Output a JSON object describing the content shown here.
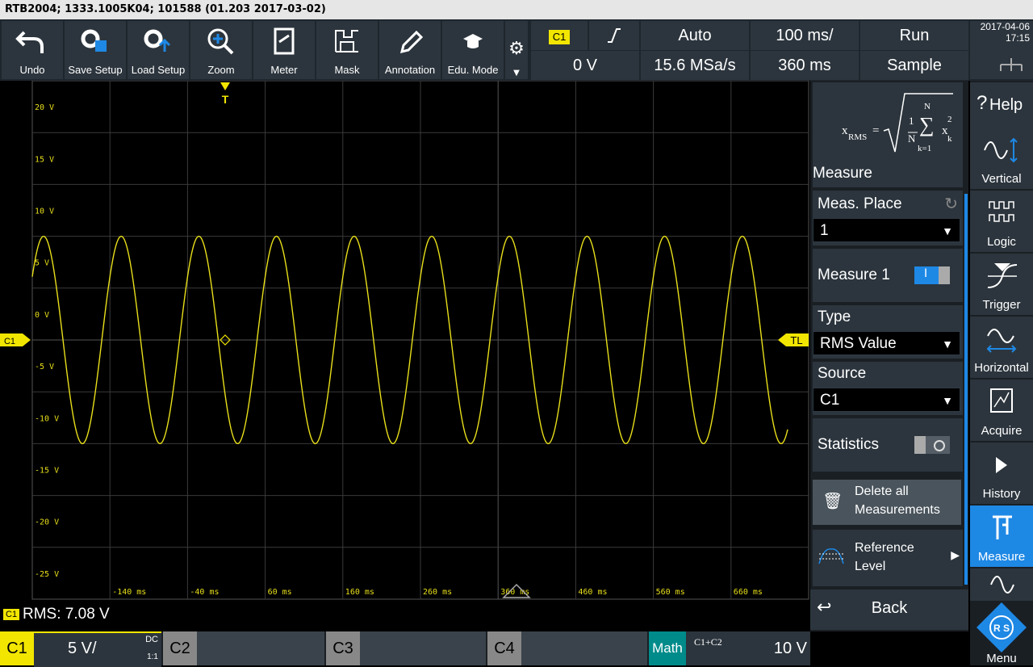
{
  "titlebar": {
    "text": "RTB2004; 1333.1005K04; 101588 (01.203 2017-03-02)"
  },
  "toolbar": {
    "undo": "Undo",
    "save_setup": "Save Setup",
    "load_setup": "Load Setup",
    "zoom": "Zoom",
    "meter": "Meter",
    "mask": "Mask",
    "annotation": "Annotation",
    "edu_mode": "Edu. Mode"
  },
  "header": {
    "trig_channel": "C1",
    "trig_level": "0 V",
    "trig_mode": "Auto",
    "sample_rate": "15.6 MSa/s",
    "time_scale": "100 ms/",
    "time_pos": "360 ms",
    "run_state": "Run",
    "acq_mode": "Sample",
    "date": "2017-04-06",
    "time": "17:15"
  },
  "grid": {
    "y_labels": [
      "20 V",
      "15 V",
      "10 V",
      "5 V",
      "0 V",
      "-5 V",
      "-10 V",
      "-15 V",
      "-20 V",
      "-25 V"
    ],
    "x_labels": [
      "-140 ms",
      "-40 ms",
      "60 ms",
      "160 ms",
      "260 ms",
      "360 ms",
      "460 ms",
      "560 ms",
      "660 ms"
    ],
    "trigger_marker": "T",
    "channel_marker": "C1",
    "trigger_level_marker": "TL"
  },
  "waveform": {
    "color": "#e8df1a",
    "amplitude_v": 10,
    "period_ms": 100
  },
  "measure_panel": {
    "formula_lhs": "x",
    "formula_sub": "RMS",
    "formula_frac_num": "1",
    "formula_frac_den": "N",
    "formula_sum_top": "N",
    "formula_sum_bottom": "k=1",
    "formula_var": "x",
    "formula_var_sup": "2",
    "formula_var_sub": "k",
    "title": "Measure",
    "meas_place_label": "Meas. Place",
    "meas_place_value": "1",
    "measure1_label": "Measure 1",
    "measure1_toggle_text": "I",
    "type_label": "Type",
    "type_value": "RMS Value",
    "source_label": "Source",
    "source_value": "C1",
    "statistics_label": "Statistics",
    "delete_all_line1": "Delete all",
    "delete_all_line2": "Measurements",
    "reference_line1": "Reference",
    "reference_line2": "Level",
    "back_label": "Back"
  },
  "rightbar": {
    "help": "Help",
    "vertical": "Vertical",
    "logic": "Logic",
    "trigger": "Trigger",
    "horizontal": "Horizontal",
    "acquire": "Acquire",
    "history": "History",
    "measure": "Measure",
    "menu": "Menu"
  },
  "status": {
    "channel": "C1",
    "rms_text": "RMS: 7.08 V"
  },
  "channels": {
    "c1_label": "C1",
    "c1_scale": "5 V/",
    "c1_coupling": "DC",
    "c1_ratio": "1:1",
    "c2_label": "C2",
    "c3_label": "C3",
    "c4_label": "C4",
    "math_label": "Math",
    "math_expr": "C1+C2",
    "math_scale": "10 V"
  },
  "colors": {
    "accent_yellow": "#f2e600",
    "accent_blue": "#1e88e5",
    "math_teal": "#008b8b"
  }
}
